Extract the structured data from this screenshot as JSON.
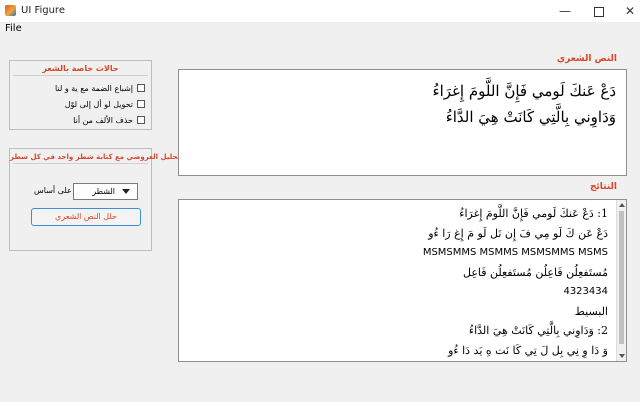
{
  "window": {
    "title": "UI Figure",
    "minimize_glyph": "—",
    "close_glyph": "✕"
  },
  "menu": {
    "file_label": "File"
  },
  "special_cases": {
    "title": "حالات خاصة بالشعر",
    "options": [
      {
        "label": "إشباع الضمة مع ية و لنا",
        "checked": false
      },
      {
        "label": "تحويل لو أل إلى لوْل",
        "checked": false
      },
      {
        "label": "حذف الألف من أنا",
        "checked": false
      }
    ]
  },
  "analysis": {
    "title": "التحليل العروضي مع كتابة شطر واحد في كل سطر",
    "basis_label": "على أساس",
    "basis_value": "الشطر",
    "analyze_button": "حلل النص الشعري"
  },
  "poem": {
    "label": "النص الشعري",
    "lines": [
      "دَعْ عَنكَ لَومي فَإِنَّ اللَّومَ إِغرَاءُ",
      "وَدَاوِني بِالَّتِي كَانَتْ هِيَ الدَّاءُ"
    ]
  },
  "results": {
    "label": "النتائج",
    "lines": [
      "1: دَعْ عَنكَ لَومي فَإِنَّ اللَّومَ إِغرَاءُ",
      "دَعْ عَن كَ لَو مِي فَ إِن نَل لَو مَ إِغ رَا ءُو",
      "MSMSMMS MSMMS MSMSMMS MSMS",
      "مُستَفعِلُن فَاعِلُن مُستَفعِلُن فَاعِل",
      "4323434",
      "البسيط",
      "2: وَدَاوِني بِالَّتِي كَانَتْ هِيَ الدَّاءُ",
      "وَ دَا وِ نِي بِل لَ تِي كَا نَت هِ يَد دَا ءُو"
    ]
  },
  "colors": {
    "accent_red": "#d9462a",
    "button_border": "#3b8fd9"
  }
}
